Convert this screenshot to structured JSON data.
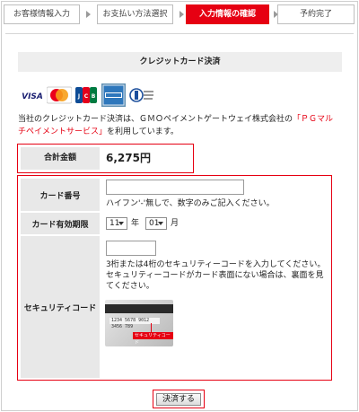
{
  "steps": [
    {
      "label": "お客様情報入力",
      "active": false
    },
    {
      "label": "お支払い方法選択",
      "active": false
    },
    {
      "label": "入力情報の確認",
      "active": true
    },
    {
      "label": "予約完了",
      "active": false
    }
  ],
  "section_title": "クレジットカード決済",
  "card_brands": [
    {
      "name": "VISA",
      "icon": "visa-logo"
    },
    {
      "name": "MasterCard",
      "icon": "mastercard-logo"
    },
    {
      "name": "JCB",
      "icon": "jcb-logo"
    },
    {
      "name": "AMERICAN EXPRESS",
      "icon": "amex-logo"
    },
    {
      "name": "Diners Club International",
      "icon": "diners-logo"
    }
  ],
  "notice": {
    "before": "当社のクレジットカード決済は、ＧＭＯペイメントゲートウェイ株式会社の",
    "link": "「ＰＧマルチペイメントサービス」",
    "after": "を利用しています。"
  },
  "total": {
    "label": "合計金額",
    "value": "6,275円"
  },
  "card_form": {
    "card_number": {
      "label": "カード番号",
      "value": "",
      "hint": "ハイフン'-'無しで、数字のみご記入ください。"
    },
    "expiry": {
      "label": "カード有効期限",
      "month": "11",
      "year_unit": "年",
      "day": "01",
      "month_unit": "月"
    },
    "security_code": {
      "label": "セキュリティコード",
      "value": "",
      "hint1": "3桁または4桁のセキュリティーコードを入力してください。",
      "hint2": "セキュリティーコードがカード表面にない場合は、裏面を見てください。",
      "image_number": "1234 5678 9012 3456 789",
      "image_tag": "セキュリティコード"
    }
  },
  "submit_label": "決済する",
  "colors": {
    "accent": "#e60012",
    "label_bg": "#e8e8e8",
    "title_bg": "#eeeeee"
  }
}
